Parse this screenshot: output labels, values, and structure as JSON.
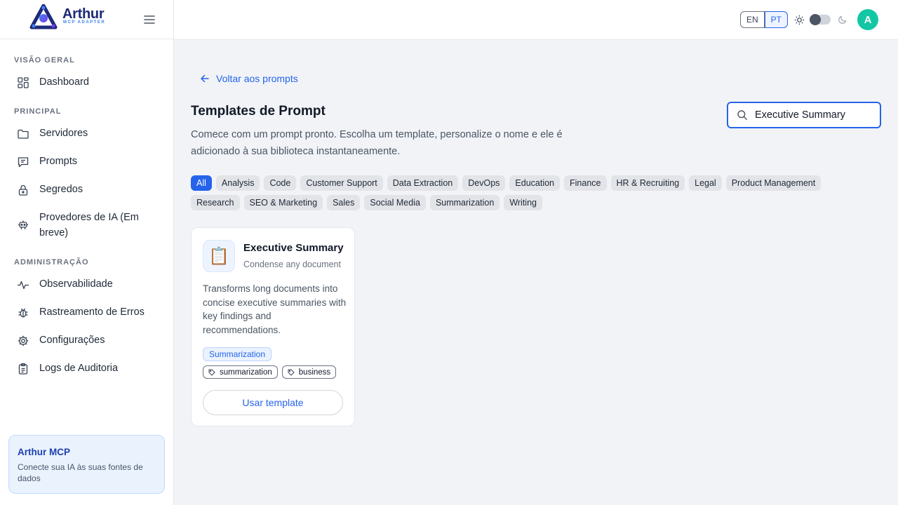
{
  "brand": {
    "name": "Arthur",
    "subtitle": "MCP ADAPTER"
  },
  "sidebar": {
    "sections": [
      {
        "title": "VISÃO GERAL"
      },
      {
        "title": "PRINCIPAL"
      },
      {
        "title": "ADMINISTRAÇÃO"
      }
    ],
    "items": [
      {
        "label": "Dashboard",
        "icon": "dashboard-icon"
      },
      {
        "label": "Servidores",
        "icon": "folder-icon"
      },
      {
        "label": "Prompts",
        "icon": "message-icon"
      },
      {
        "label": "Segredos",
        "icon": "lock-icon"
      },
      {
        "label": "Provedores de IA (Em breve)",
        "icon": "robot-icon"
      },
      {
        "label": "Observabilidade",
        "icon": "activity-icon"
      },
      {
        "label": "Rastreamento de Erros",
        "icon": "bug-icon"
      },
      {
        "label": "Configurações",
        "icon": "gear-icon"
      },
      {
        "label": "Logs de Auditoria",
        "icon": "clipboard-icon"
      }
    ],
    "promo": {
      "title": "Arthur MCP",
      "description": "Conecte sua IA às suas fontes de dados"
    }
  },
  "header": {
    "languages": [
      "EN",
      "PT"
    ],
    "active_language": "PT",
    "avatar_initial": "A",
    "accent": "#14c7a4"
  },
  "main": {
    "back_label": "Voltar aos prompts",
    "title": "Templates de Prompt",
    "description": "Comece com um prompt pronto. Escolha um template, personalize o nome e ele é adicionado à sua biblioteca instantaneamente.",
    "search": {
      "value": "Executive Summary"
    },
    "categories": [
      "All",
      "Analysis",
      "Code",
      "Customer Support",
      "Data Extraction",
      "DevOps",
      "Education",
      "Finance",
      "HR & Recruiting",
      "Legal",
      "Product Management",
      "Research",
      "SEO & Marketing",
      "Sales",
      "Social Media",
      "Summarization",
      "Writing"
    ],
    "active_category": "All",
    "card": {
      "emoji": "📋",
      "title": "Executive Summary",
      "subtitle": "Condense any document",
      "description": "Transforms long documents into concise executive summaries with key findings and recommendations.",
      "category": "Summarization",
      "tags": [
        "summarization",
        "business"
      ],
      "action_label": "Usar template"
    }
  },
  "colors": {
    "primary": "#2563eb",
    "brand_dark": "#1e2a78"
  }
}
